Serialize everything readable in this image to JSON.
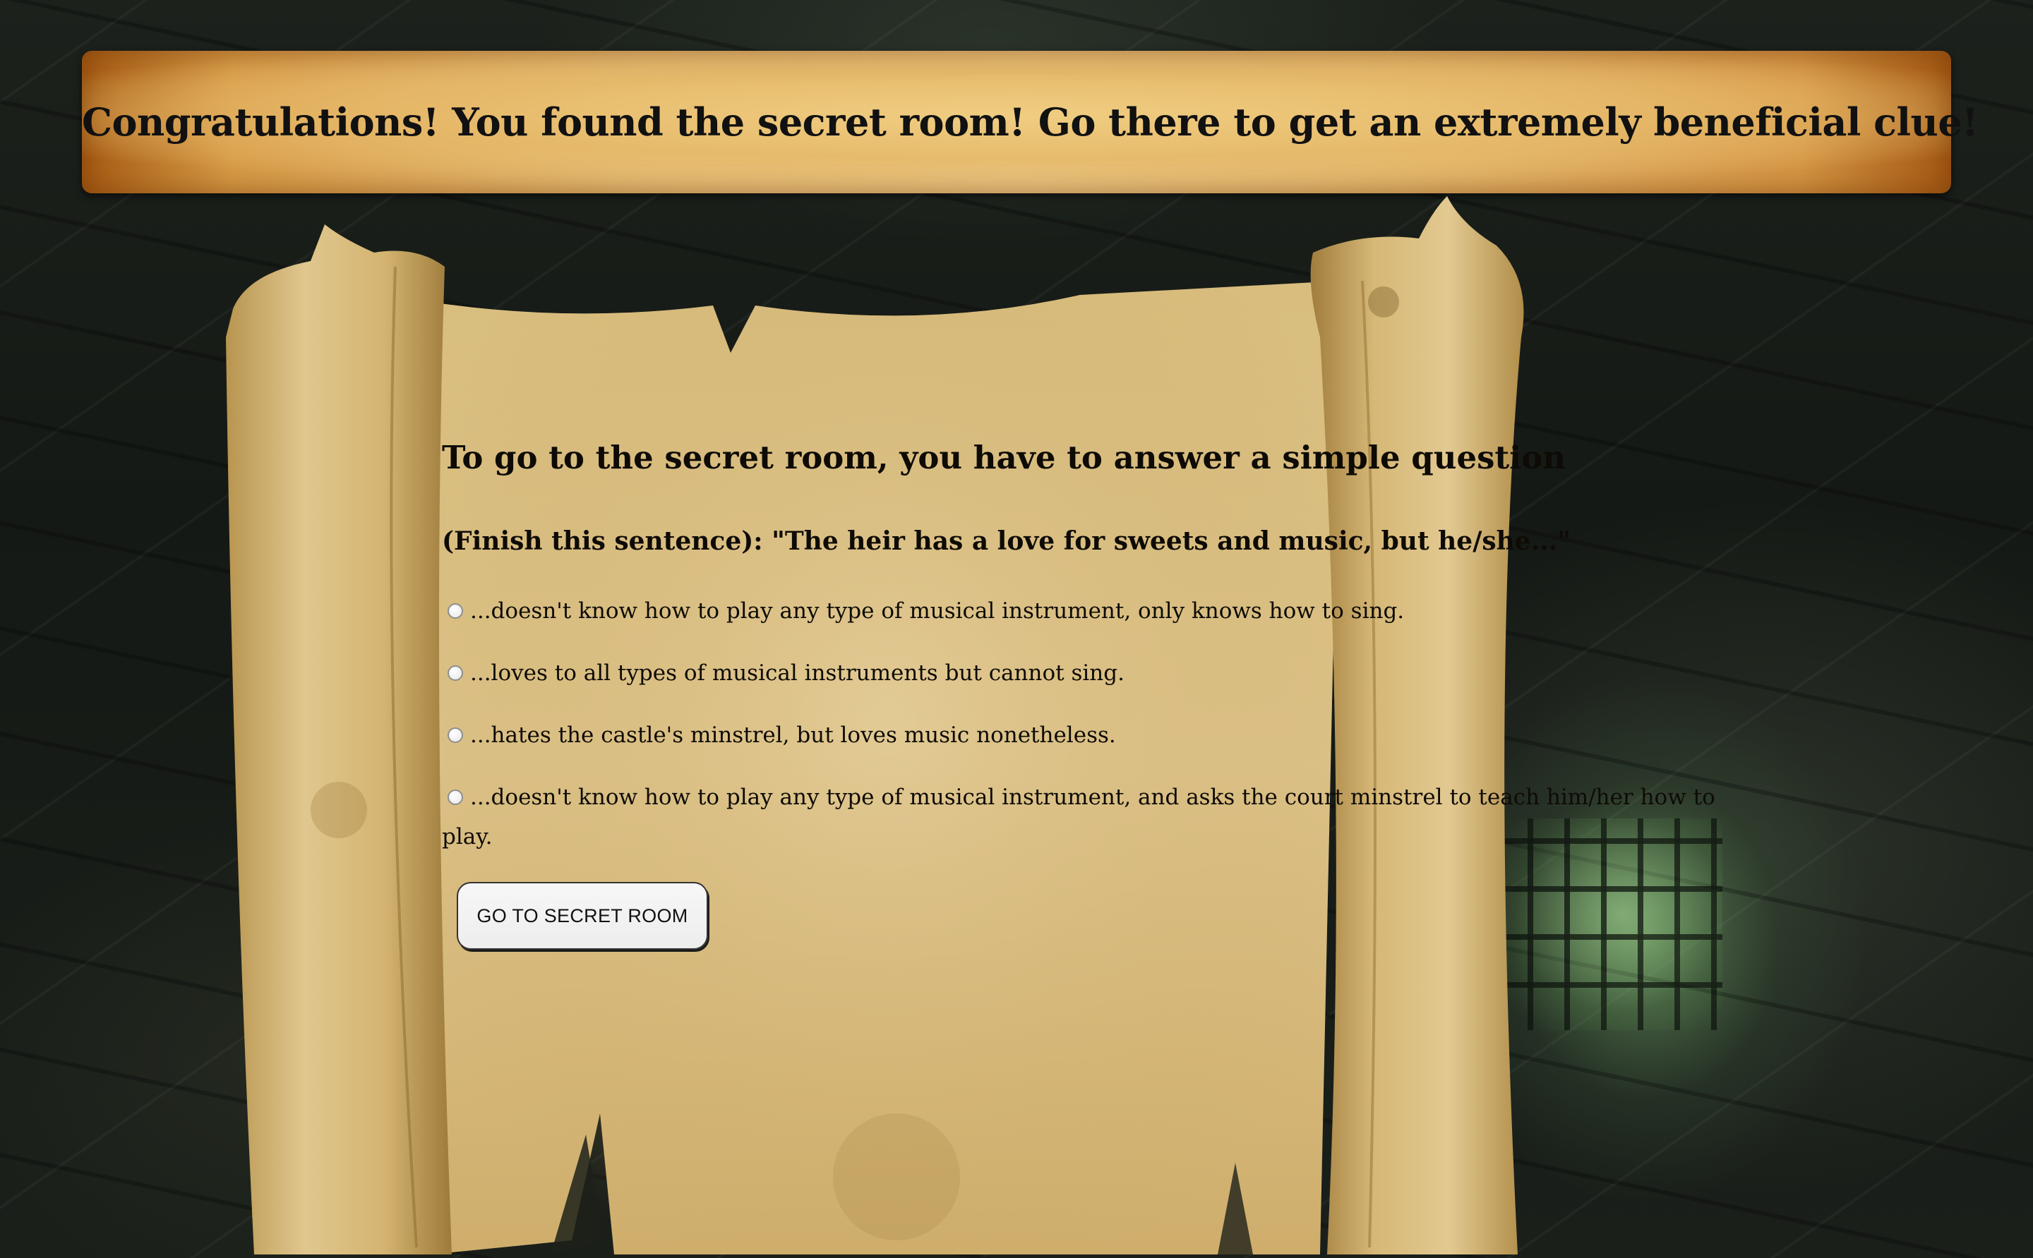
{
  "banner": {
    "text": "Congratulations! You found the secret room! Go there to get an extremely beneficial clue!"
  },
  "quiz": {
    "heading": "To go to the secret room, you have to answer a simple question",
    "prompt": "(Finish this sentence): \"The heir has a love for sweets and music, but he/she...\"",
    "options": [
      {
        "label": "...doesn't know how to play any type of musical instrument, only knows how to sing.",
        "selected": false
      },
      {
        "label": "...loves to all types of musical instruments but cannot sing.",
        "selected": false
      },
      {
        "label": "...hates the castle's minstrel, but loves music nonetheless.",
        "selected": false
      },
      {
        "label": "...doesn't know how to play any type of musical instrument, and asks the court minstrel to teach him/her how to",
        "selected": false
      }
    ],
    "option4_continuation": "play.",
    "submit_label": "GO TO SECRET ROOM"
  }
}
